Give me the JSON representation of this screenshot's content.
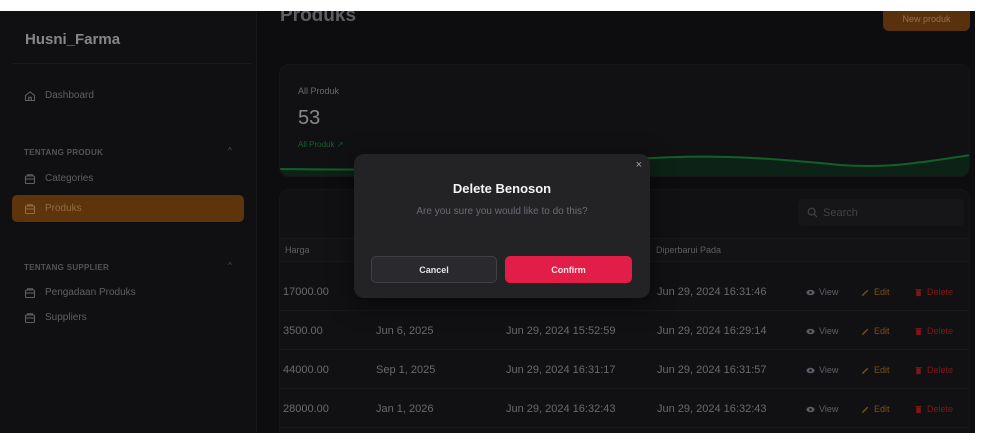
{
  "app": {
    "brand": "Husni_Farma",
    "page_title": "Produks",
    "new_button": "New produk"
  },
  "sidebar": {
    "dashboard": "Dashboard",
    "groups": [
      {
        "label": "TENTANG PRODUK",
        "items": [
          "Categories",
          "Produks"
        ]
      },
      {
        "label": "TENTANG SUPPLIER",
        "items": [
          "Pengadaan Produks",
          "Suppliers"
        ]
      }
    ],
    "active_item": "Produks"
  },
  "stats": {
    "label": "All Produk",
    "value": "53",
    "description": "All Produk"
  },
  "table": {
    "search_placeholder": "Search",
    "columns": [
      "Harga",
      "",
      "",
      "Diperbarui Pada"
    ],
    "rows": [
      [
        "17000.00",
        "",
        "",
        "Jun 29, 2024 16:31:46"
      ],
      [
        "3500.00",
        "Jun 6, 2025",
        "Jun 29, 2024 15:52:59",
        "Jun 29, 2024 16:29:14"
      ],
      [
        "44000.00",
        "Sep 1, 2025",
        "Jun 29, 2024 16:31:17",
        "Jun 29, 2024 16:31:57"
      ],
      [
        "28000.00",
        "Jan 1, 2026",
        "Jun 29, 2024 16:32:43",
        "Jun 29, 2024 16:32:43"
      ]
    ],
    "actions": {
      "view": "View",
      "edit": "Edit",
      "delete": "Delete"
    }
  },
  "modal": {
    "title": "Delete Benoson",
    "description": "Are you sure you would like to do this?",
    "cancel": "Cancel",
    "confirm": "Confirm",
    "close": "×"
  },
  "colors": {
    "accent": "#a35b15",
    "danger": "#e11d48",
    "success": "#22a34a",
    "background": "#18181b"
  }
}
